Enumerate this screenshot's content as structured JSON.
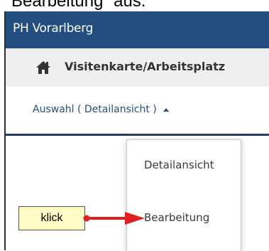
{
  "cut_heading": "Bearbeitung“ aus.",
  "app": {
    "title": "PH Vorarlberg"
  },
  "nav": {
    "title": "Visitenkarte/Arbeitsplatz",
    "home_icon": "home-icon"
  },
  "tab": {
    "label": "Auswahl ( Detailansicht )"
  },
  "menu": {
    "items": [
      {
        "label": "Detailansicht"
      },
      {
        "label": "Bearbeitung"
      }
    ]
  },
  "annotation": {
    "label": "klick"
  },
  "colors": {
    "header": "#224d7e",
    "nav_bg": "#efefef",
    "tab_border": "#243e69",
    "arrow": "#e02020",
    "note_bg": "#fffcc5"
  }
}
